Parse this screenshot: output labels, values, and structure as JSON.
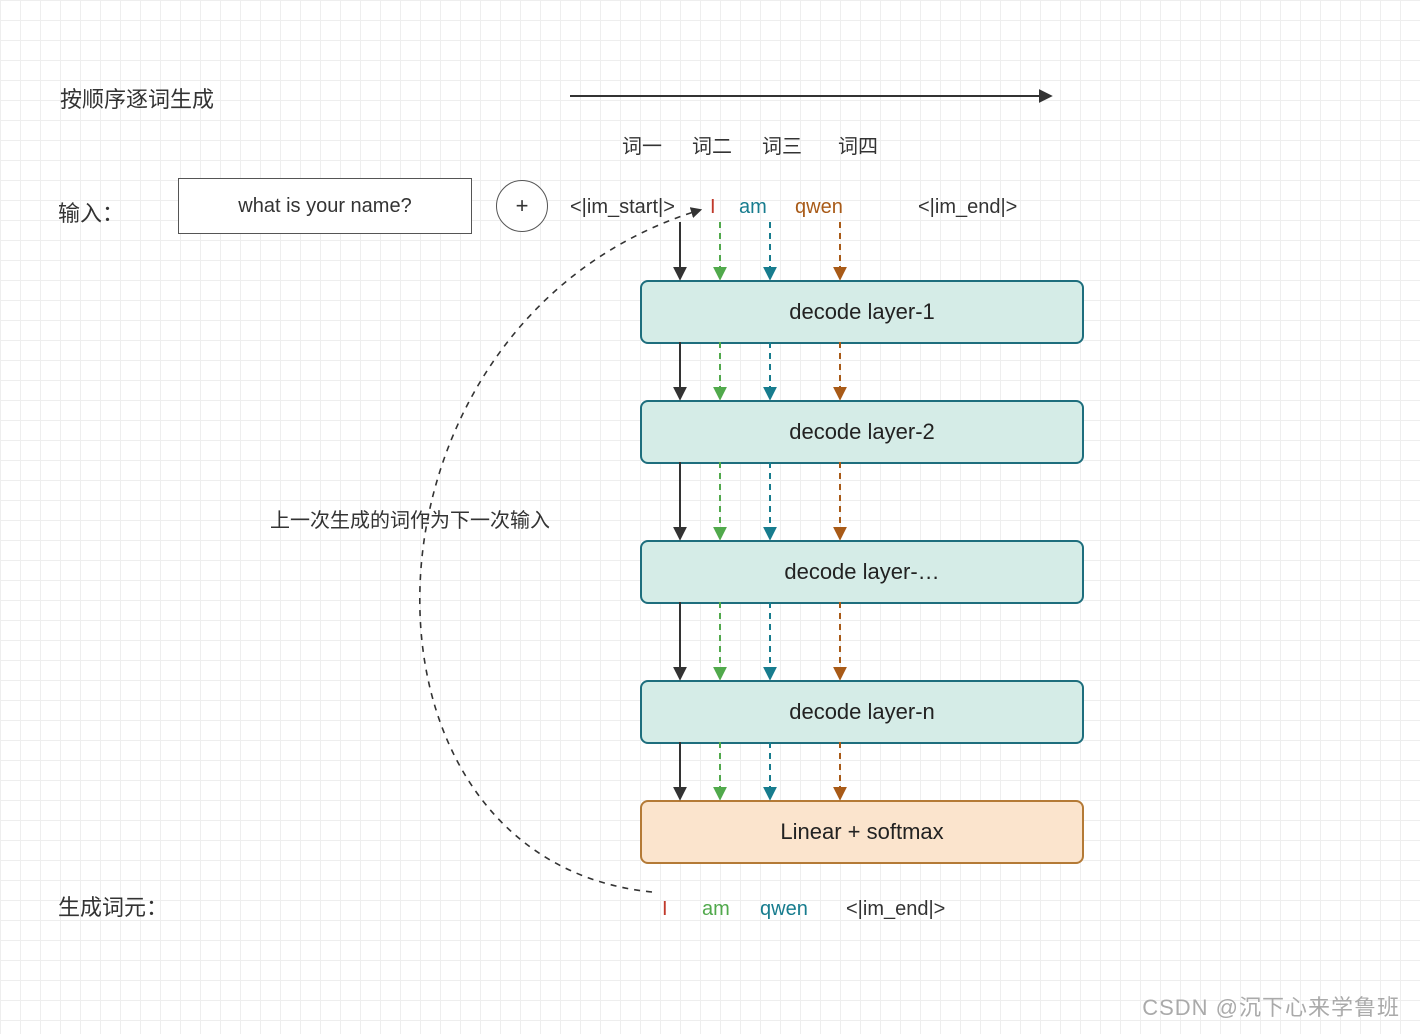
{
  "header_text": "按顺序逐词生成",
  "word_headers": [
    "词一",
    "词二",
    "词三",
    "词四"
  ],
  "input_label": "输入：",
  "input_text": "what is your name?",
  "plus_symbol": "+",
  "top_tokens": {
    "im_start": "<|im_start|>",
    "t1": "I",
    "t2": "am",
    "t3": "qwen",
    "im_end": "<|im_end|>"
  },
  "feedback_note": "上一次生成的词作为下一次输入",
  "layers": {
    "l1": "decode layer-1",
    "l2": "decode layer-2",
    "ldots": "decode layer-…",
    "ln": "decode layer-n",
    "out": "Linear + softmax"
  },
  "output_label": "生成词元：",
  "output_tokens": {
    "o1": "I",
    "o2": "am",
    "o3": "qwen",
    "o4": "<|im_end|>"
  },
  "watermark": "CSDN @沉下心来学鲁班",
  "colors": {
    "black": "#333333",
    "red": "#c0392b",
    "green": "#51a94c",
    "teal": "#177c8e",
    "brown": "#a85a17"
  }
}
